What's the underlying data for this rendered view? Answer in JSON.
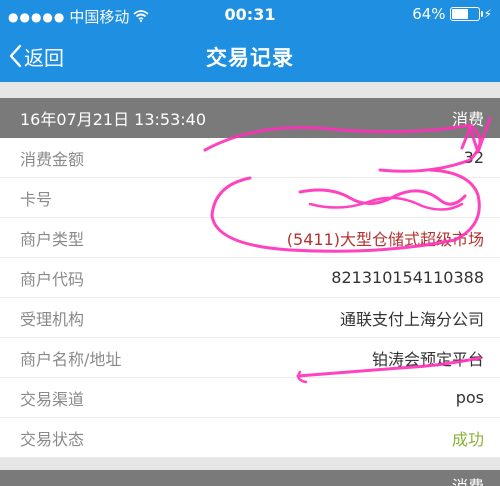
{
  "status_bar": {
    "carrier": "中国移动",
    "time": "00:31",
    "battery_percent": "64%",
    "battery_level": 0.64
  },
  "nav": {
    "back_label": "返回",
    "title": "交易记录"
  },
  "record": {
    "datetime": "16年07月21日 13:53:40",
    "type": "消费",
    "fields": [
      {
        "label": "消费金额",
        "value": "32"
      },
      {
        "label": "卡号",
        "value": ""
      },
      {
        "label": "商户类型",
        "value": "(5411)大型仓储式超级市场"
      },
      {
        "label": "商户代码",
        "value": "821310154110388"
      },
      {
        "label": "受理机构",
        "value": "通联支付上海分公司"
      },
      {
        "label": "商户名称/地址",
        "value": "铂涛会预定平台"
      },
      {
        "label": "交易渠道",
        "value": "pos"
      },
      {
        "label": "交易状态",
        "value": "成功"
      }
    ]
  },
  "next_record": {
    "type": "消费"
  },
  "colors": {
    "accent": "#1e8fe1",
    "header_gray": "#7a7a7a",
    "merchant_red": "#b5332f",
    "success_green": "#88b33a",
    "scribble_pink": "#ff2fb8"
  }
}
